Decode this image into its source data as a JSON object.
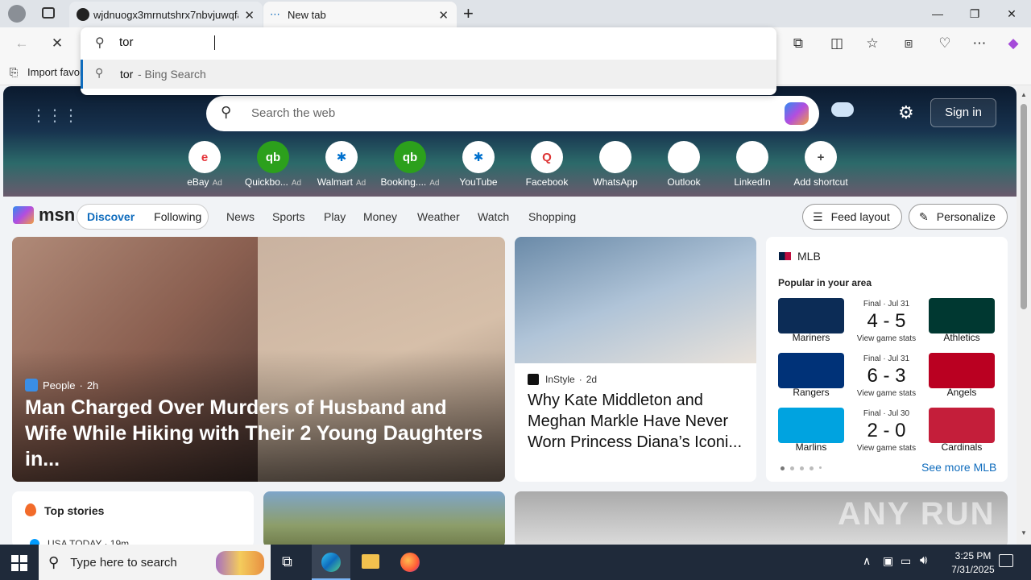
{
  "browser": {
    "tabs": [
      {
        "title": "wjdnuogx3mrnutshrx7nbvjuwqfa",
        "active": false
      },
      {
        "title": "New tab",
        "active": true
      }
    ],
    "address_input": "tor",
    "suggestion": {
      "query": "tor",
      "suffix": " - Bing Search"
    },
    "favorites_bar": {
      "import_label": "Import favor"
    }
  },
  "newtab": {
    "search_placeholder": "Search the web",
    "sign_in": "Sign in",
    "shortcuts": [
      {
        "label": "eBay",
        "ad": "Ad",
        "color": "#e53238",
        "glyph": "e"
      },
      {
        "label": "Quickbo...",
        "ad": "Ad",
        "color": "#2ca01c",
        "glyph": "qb"
      },
      {
        "label": "Walmart",
        "ad": "Ad",
        "color": "#0071ce",
        "glyph": "✱"
      },
      {
        "label": "Booking....",
        "ad": "Ad",
        "color": "#2ca01c",
        "glyph": "qb"
      },
      {
        "label": "YouTube",
        "ad": "",
        "color": "#0071ce",
        "glyph": "✱"
      },
      {
        "label": "Facebook",
        "ad": "",
        "color": "#d33",
        "glyph": "Q"
      },
      {
        "label": "WhatsApp",
        "ad": "",
        "color": "#fff",
        "glyph": ""
      },
      {
        "label": "Outlook",
        "ad": "",
        "color": "#fff",
        "glyph": ""
      },
      {
        "label": "LinkedIn",
        "ad": "",
        "color": "#fff",
        "glyph": ""
      },
      {
        "label": "Add shortcut",
        "ad": "",
        "color": "#444",
        "glyph": "+"
      }
    ]
  },
  "msn_nav": {
    "logo": "msn",
    "tabs": [
      "Discover",
      "Following"
    ],
    "links": [
      "News",
      "Sports",
      "Play",
      "Money",
      "Weather",
      "Watch",
      "Shopping"
    ],
    "feed_layout": "Feed layout",
    "personalize": "Personalize"
  },
  "main_story": {
    "source": "People",
    "age": "2h",
    "headline": "Man Charged Over Murders of Husband and Wife While Hiking with Their 2 Young Daughters in..."
  },
  "diana_story": {
    "source": "InStyle",
    "age": "2d",
    "headline": "Why Kate Middleton and Meghan Markle Have Never Worn Princess Diana’s Iconi..."
  },
  "mlb": {
    "title": "MLB",
    "subtitle": "Popular in your area",
    "games": [
      {
        "status": "Final · Jul 31",
        "score": "4 - 5",
        "stats": "View game stats",
        "home": "Mariners",
        "away": "Athletics",
        "home_color": "#0c2c56",
        "away_color": "#003831"
      },
      {
        "status": "Final · Jul 31",
        "score": "6 - 3",
        "stats": "View game stats",
        "home": "Rangers",
        "away": "Angels",
        "home_color": "#003278",
        "away_color": "#ba0021"
      },
      {
        "status": "Final · Jul 30",
        "score": "2 - 0",
        "stats": "View game stats",
        "home": "Marlins",
        "away": "Cardinals",
        "home_color": "#00a3e0",
        "away_color": "#c41e3a"
      }
    ],
    "see_more": "See more MLB"
  },
  "top_stories": {
    "title": "Top stories",
    "first_source": "USA TODAY · 19m"
  },
  "taskbar": {
    "search_placeholder": "Type here to search",
    "time": "3:25 PM",
    "date": "7/31/2025"
  },
  "watermark": "ANY RUN"
}
